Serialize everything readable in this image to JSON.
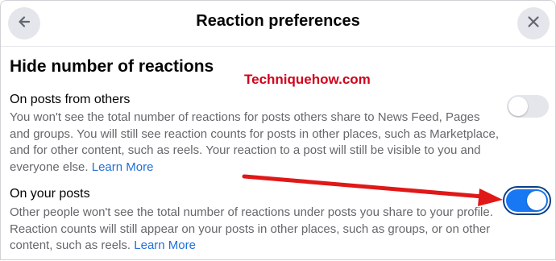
{
  "header": {
    "title": "Reaction preferences",
    "back_icon": "arrow-left-icon",
    "close_icon": "close-icon"
  },
  "section": {
    "heading": "Hide number of reactions"
  },
  "watermark": "Techniquehow.com",
  "options": [
    {
      "title": "On posts from others",
      "description": "You won't see the total number of reactions for posts others share to News Feed, Pages and groups. You will still see reaction counts for posts in other places, such as Marketplace, and for other content, such as reels. Your reaction to a post will still be visible to you and everyone else.",
      "learn_more": "Learn More",
      "enabled": false
    },
    {
      "title": "On your posts",
      "description": "Other people won't see the total number of reactions under posts you share to your profile. Reaction counts will still appear on your posts in other places, such as groups, or on other content, such as reels.",
      "learn_more": "Learn More",
      "enabled": true
    }
  ],
  "colors": {
    "accent": "#1877f2",
    "annotation_arrow": "#e01818",
    "watermark": "#d0021b"
  }
}
